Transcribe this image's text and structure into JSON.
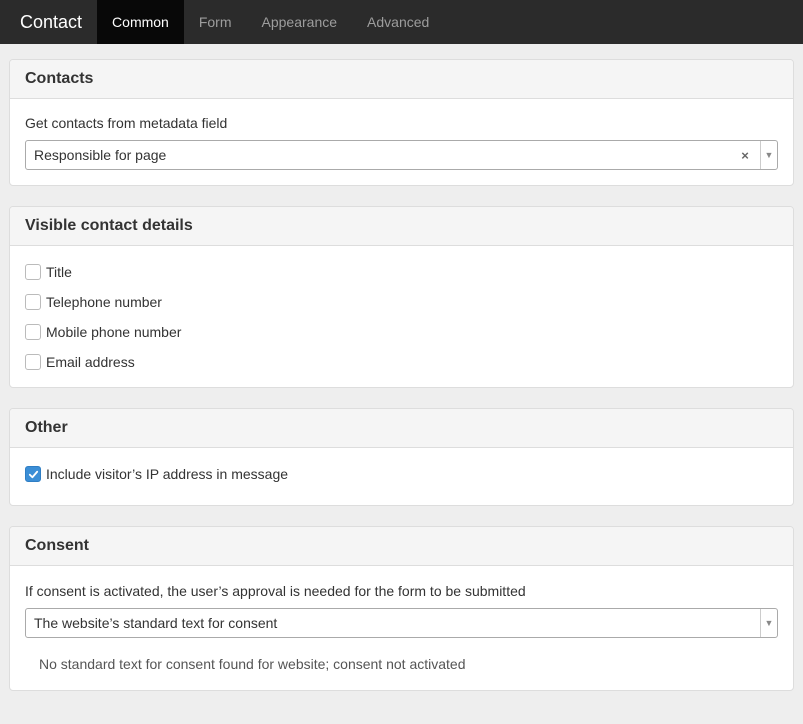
{
  "nav": {
    "brand": "Contact",
    "tabs": [
      {
        "label": "Common",
        "active": true
      },
      {
        "label": "Form",
        "active": false
      },
      {
        "label": "Appearance",
        "active": false
      },
      {
        "label": "Advanced",
        "active": false
      }
    ]
  },
  "contacts": {
    "heading": "Contacts",
    "field_label": "Get contacts from metadata field",
    "select_value": "Responsible for page",
    "clear_glyph": "×",
    "arrow_glyph": "▼"
  },
  "visible": {
    "heading": "Visible contact details",
    "items": [
      {
        "label": "Title",
        "checked": false
      },
      {
        "label": "Telephone number",
        "checked": false
      },
      {
        "label": "Mobile phone number",
        "checked": false
      },
      {
        "label": "Email address",
        "checked": false
      }
    ]
  },
  "other": {
    "heading": "Other",
    "items": [
      {
        "label": "Include visitor’s IP address in message",
        "checked": true
      }
    ]
  },
  "consent": {
    "heading": "Consent",
    "field_label": "If consent is activated, the user’s approval is needed for the form to be submitted",
    "select_value": "The website’s standard text for consent",
    "arrow_glyph": "▼",
    "note": "No standard text for consent found for website; consent not activated"
  },
  "colors": {
    "topbar": "#2b2b2b",
    "active_tab": "#080808",
    "checkbox_checked": "#3b8ed6"
  }
}
